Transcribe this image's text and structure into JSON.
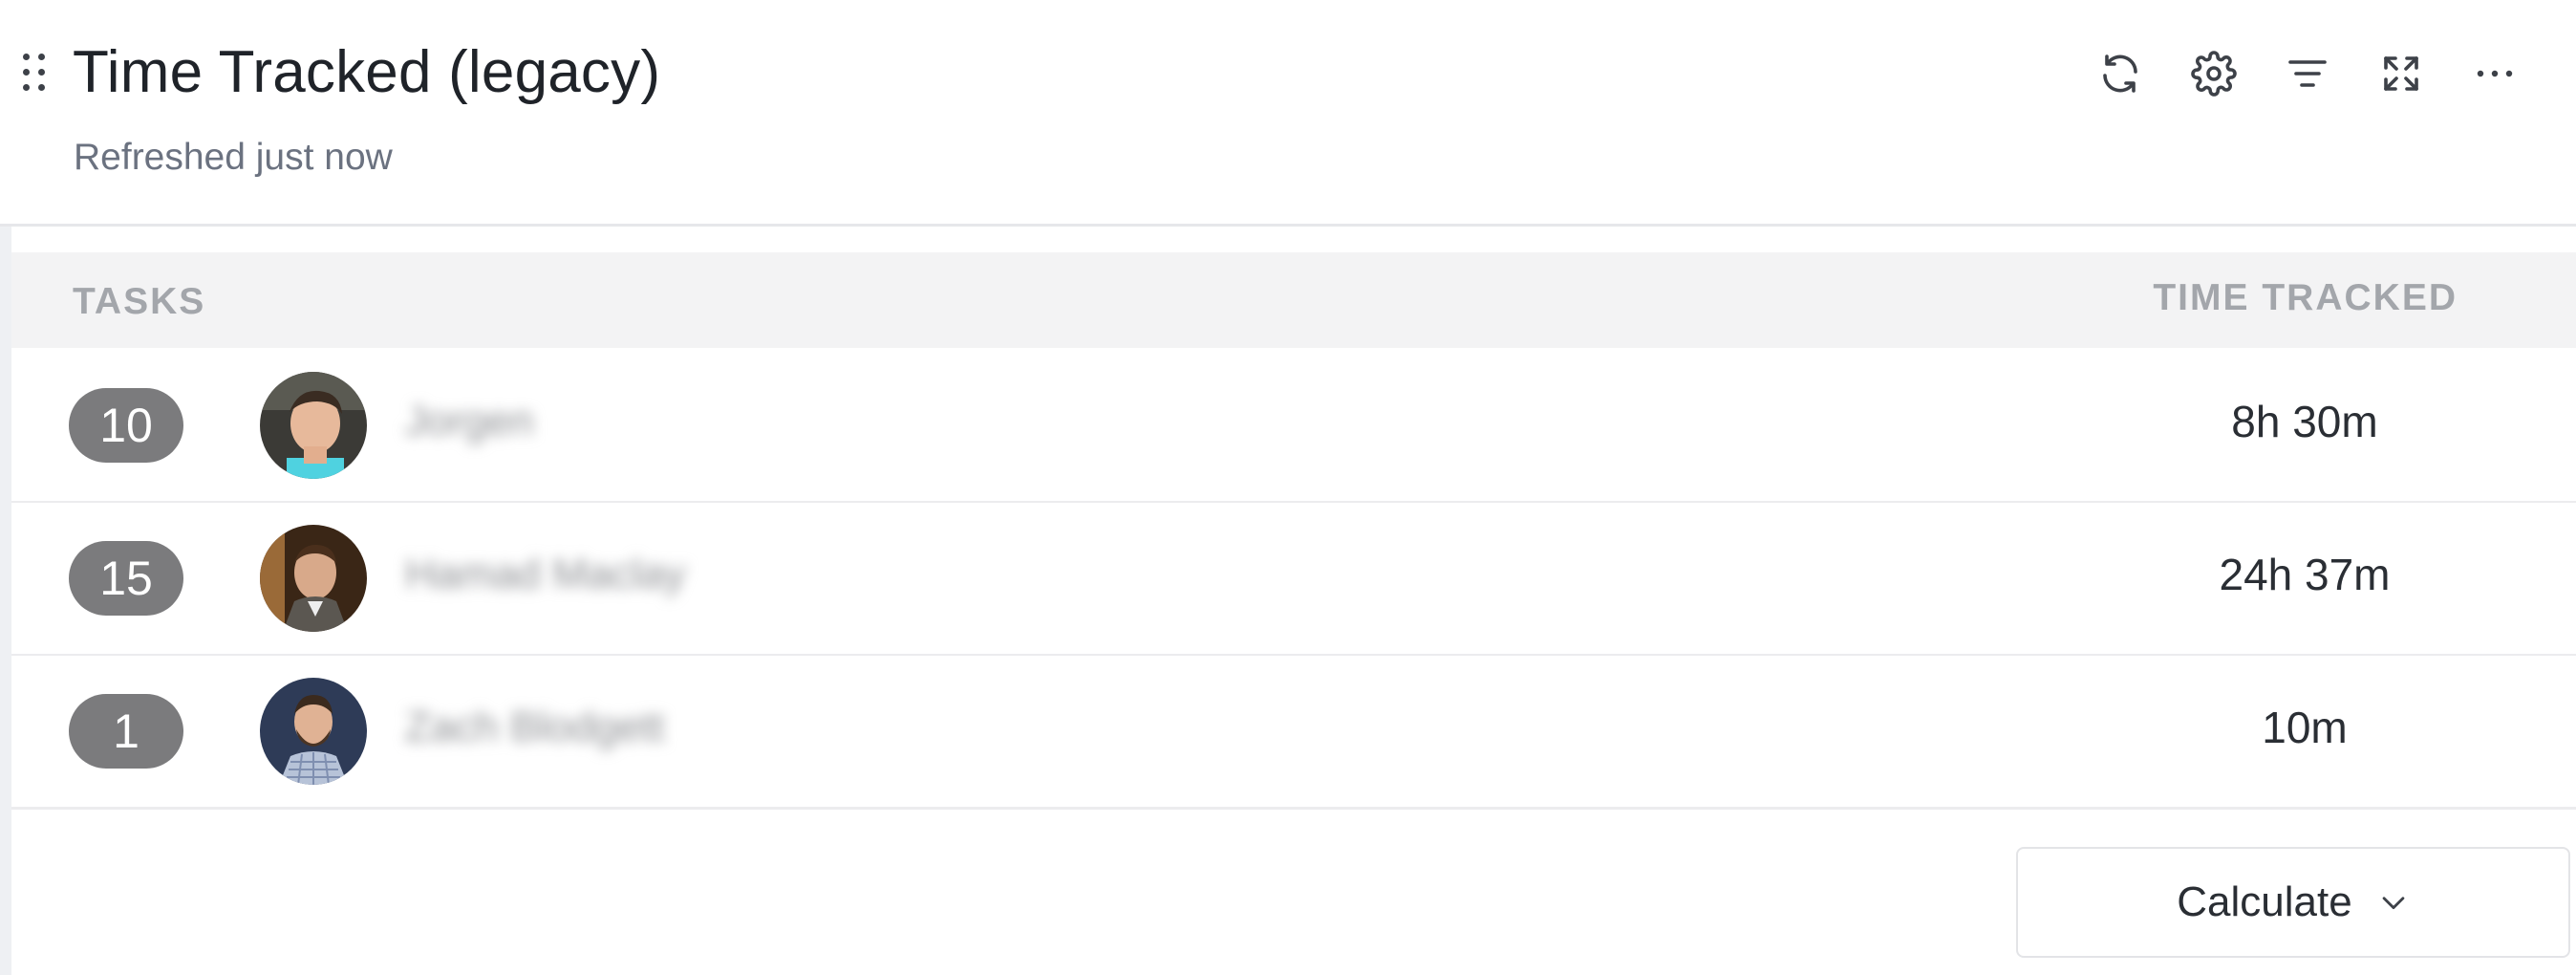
{
  "widget": {
    "title": "Time Tracked (legacy)",
    "subtitle": "Refreshed just now"
  },
  "toolbar": {
    "icons": [
      "refresh-icon",
      "gear-icon",
      "filter-icon",
      "expand-icon",
      "more-icon"
    ]
  },
  "table": {
    "columns": {
      "tasks": "TASKS",
      "time": "TIME TRACKED"
    },
    "rows": [
      {
        "tasks": "10",
        "name": "Jorgen",
        "time": "8h 30m"
      },
      {
        "tasks": "15",
        "name": "Hamad Maclay",
        "time": "24h 37m"
      },
      {
        "tasks": "1",
        "name": "Zach Blodgett",
        "time": "10m"
      }
    ]
  },
  "footer": {
    "calculate_label": "Calculate"
  },
  "colors": {
    "badge": "#7b7b7d",
    "header_bg": "#f3f3f4",
    "text": "#2a2e34",
    "muted": "#6b7280"
  }
}
